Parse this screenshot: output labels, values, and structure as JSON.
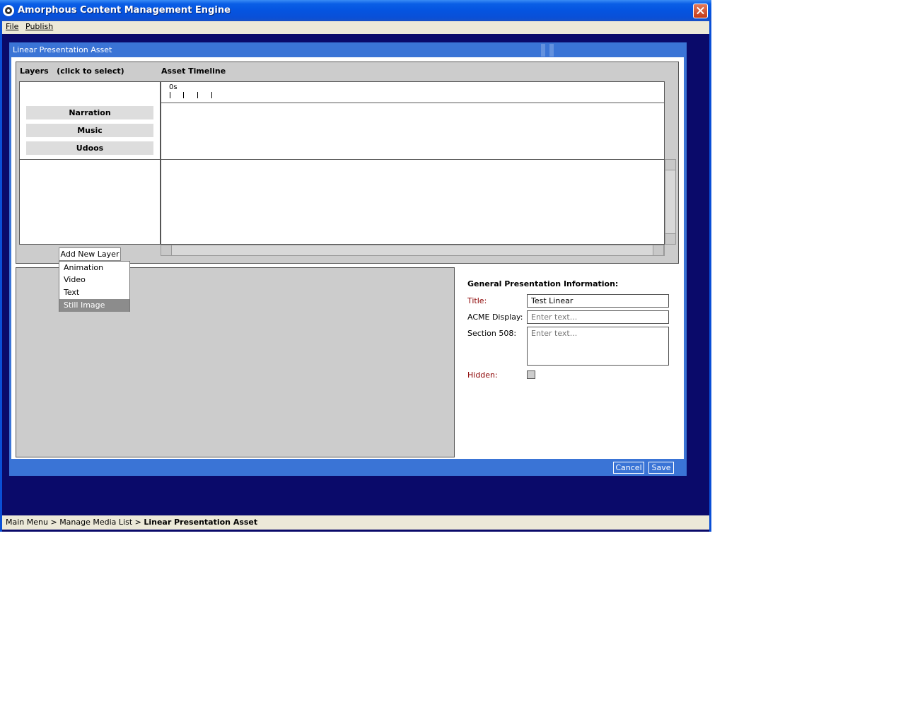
{
  "window": {
    "title": "Amorphous Content Management Engine"
  },
  "menu": {
    "file": "File",
    "publish": "Publish"
  },
  "dialog": {
    "title": "Linear Presentation Asset",
    "layers_heading": "Layers   (click to select)",
    "timeline_heading": "Asset Timeline",
    "ruler_label": "0s",
    "layers": [
      "Narration",
      "Music",
      "Udoos"
    ],
    "add_layer_button": "Add New Layer",
    "add_layer_options": [
      "Animation",
      "Video",
      "Text",
      "Still Image"
    ],
    "selected_option": "Still Image",
    "cancel": "Cancel",
    "save": "Save"
  },
  "info": {
    "heading": "General Presentation Information:",
    "title_label": "Title:",
    "title_value": "Test Linear",
    "acme_label": "ACME Display:",
    "acme_placeholder": "Enter text...",
    "section508_label": "Section 508:",
    "section508_placeholder": "Enter text...",
    "hidden_label": "Hidden:",
    "hidden_checked": false
  },
  "breadcrumb": {
    "main_menu": "Main Menu",
    "separator": ">",
    "manage_media": "Manage Media List",
    "current": "Linear Presentation Asset"
  },
  "colors": {
    "title_bar": "#0554e0",
    "dialog_frame": "#3a74d6",
    "desktop_bg": "#0a0a6a",
    "required_label": "#8b0000"
  },
  "icons": {
    "app": "gear-icon",
    "close": "close-icon"
  }
}
